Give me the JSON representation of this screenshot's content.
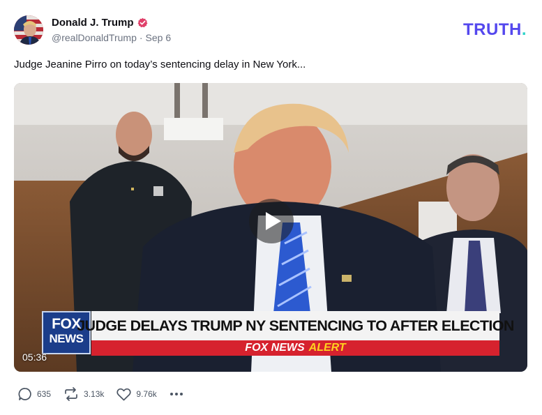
{
  "post": {
    "author_name": "Donald J. Trump",
    "handle": "@realDonaldTrump",
    "separator": "·",
    "date": "Sep 6",
    "text": "Judge Jeanine Pirro on today’s sentencing delay in New York...",
    "verified_icon": "verified-badge-icon",
    "accent_color": "#5448ee"
  },
  "brand": {
    "name": "TRUTH",
    "dot": "."
  },
  "video": {
    "duration": "05:36",
    "chyron_headline": "JUDGE DELAYS TRUMP NY SENTENCING TO AFTER ELECTION",
    "alert_brand": "FOX NEWS",
    "alert_word": "ALERT",
    "logo_line1": "FOX",
    "logo_line2": "NEWS",
    "play_icon": "play-icon"
  },
  "actions": {
    "replies": "635",
    "retruths": "3.13k",
    "likes": "9.76k",
    "reply_icon": "reply-bubble-icon",
    "retruth_icon": "retruth-arrows-icon",
    "like_icon": "heart-icon",
    "more_icon": "more-dots-icon"
  }
}
